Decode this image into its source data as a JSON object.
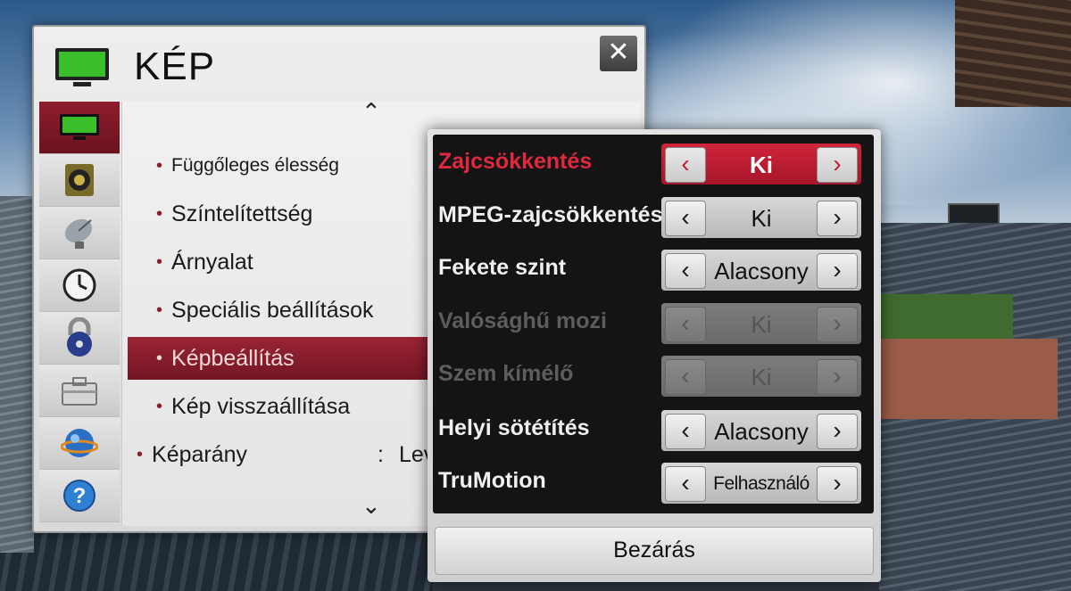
{
  "main": {
    "title": "KÉP",
    "close_symbol": "✕",
    "scroll_up": "⌃",
    "scroll_down": "⌄",
    "bullet": "•",
    "side_tabs": [
      {
        "icon": "tv-picture-icon",
        "active": true
      },
      {
        "icon": "speaker-icon",
        "active": false
      },
      {
        "icon": "satellite-dish-icon",
        "active": false
      },
      {
        "icon": "clock-icon",
        "active": false
      },
      {
        "icon": "lock-icon",
        "active": false
      },
      {
        "icon": "toolbox-icon",
        "active": false
      },
      {
        "icon": "network-globe-icon",
        "active": false
      },
      {
        "icon": "help-icon",
        "active": false
      }
    ],
    "items": [
      {
        "label": "Függőleges élesség"
      },
      {
        "label": "Színtelítettség"
      },
      {
        "label": "Árnyalat"
      },
      {
        "label": "Speciális beállítások"
      },
      {
        "label": "Képbeállítás",
        "active": true
      },
      {
        "label": "Kép visszaállítása"
      }
    ],
    "aspect": {
      "label": "Képarány",
      "separator": ":",
      "value": "Lev"
    }
  },
  "popup": {
    "rows": [
      {
        "label": "Zajcsökkentés",
        "value": "Ki",
        "state": "selected"
      },
      {
        "label": "MPEG-zajcsökkentés",
        "value": "Ki",
        "state": "normal"
      },
      {
        "label": "Fekete szint",
        "value": "Alacsony",
        "state": "normal"
      },
      {
        "label": "Valósághű mozi",
        "value": "Ki",
        "state": "disabled"
      },
      {
        "label": "Szem kímélő",
        "value": "Ki",
        "state": "disabled"
      },
      {
        "label": "Helyi sötétítés",
        "value": "Alacsony",
        "state": "normal"
      },
      {
        "label": "TruMotion",
        "value": "Felhasználó",
        "state": "normal"
      }
    ],
    "left_arrow": "‹",
    "right_arrow": "›",
    "close_label": "Bezárás"
  },
  "colors": {
    "accent": "#8e1d2c",
    "selected_red": "#d0243a",
    "popup_bg": "#141414"
  }
}
